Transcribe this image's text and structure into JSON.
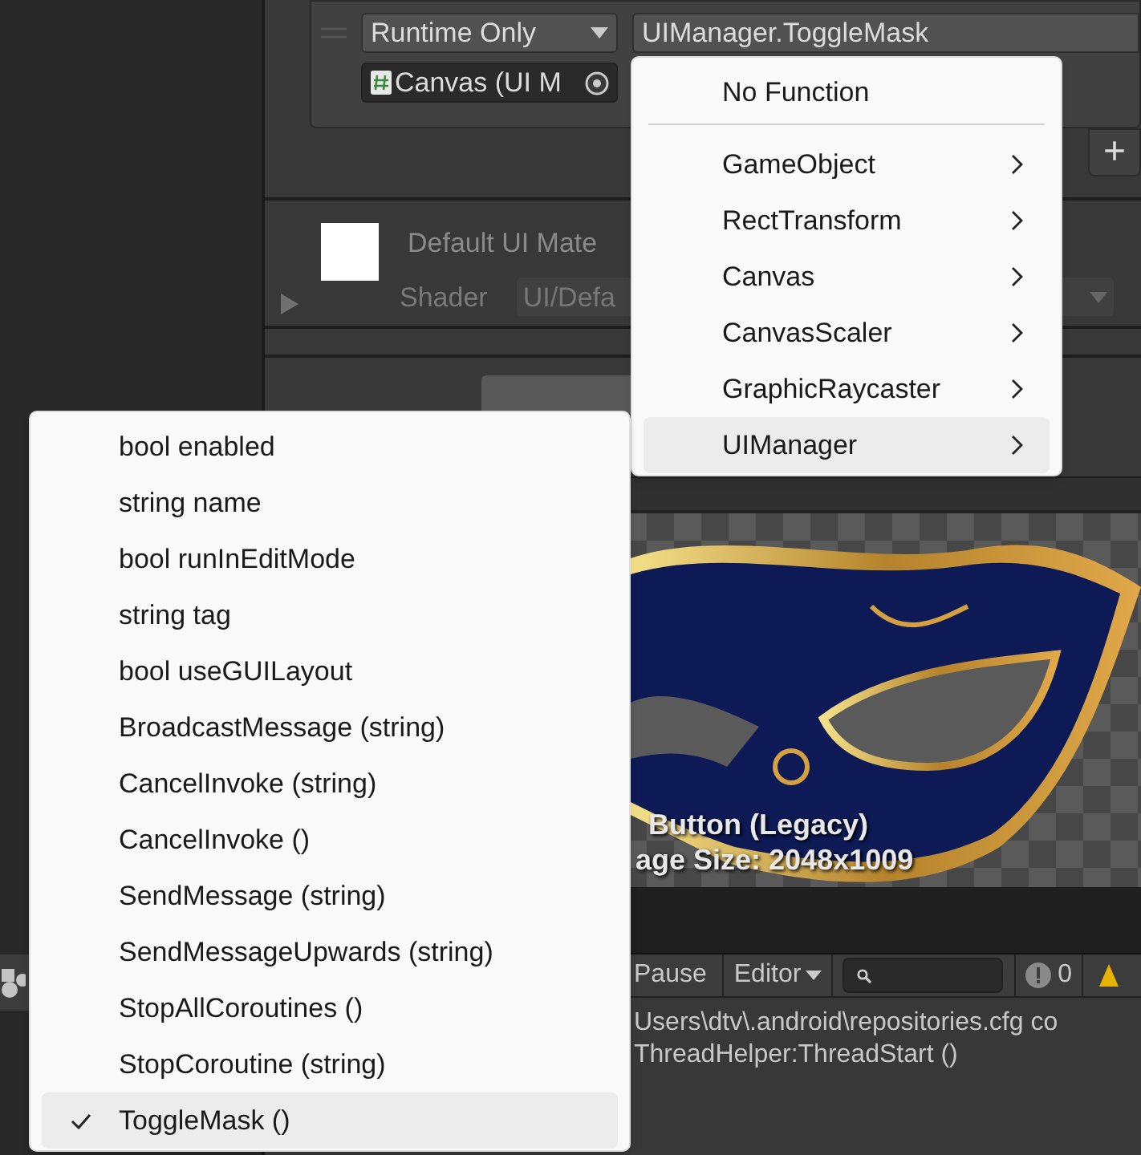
{
  "event": {
    "mode_dropdown": "Runtime Only",
    "function_field": "UIManager.ToggleMask",
    "target_field": "Canvas (UI M",
    "add_button": "+"
  },
  "material": {
    "name": "Default UI Mate",
    "shader_label": "Shader",
    "shader_dropdown": "UI/Defa"
  },
  "preview": {
    "lines": [
      "Button (Legacy)",
      "age Size: 2048x1009"
    ]
  },
  "console": {
    "pause": "Pause",
    "editor": "Editor",
    "error_count": "0",
    "lines": [
      "Users\\dtv\\.android\\repositories.cfg co",
      "ThreadHelper:ThreadStart ()"
    ]
  },
  "function_menu": {
    "items": [
      {
        "kind": "plain",
        "label": "No Function",
        "selected": false
      },
      {
        "kind": "separator"
      },
      {
        "kind": "submenu",
        "label": "GameObject",
        "selected": false
      },
      {
        "kind": "submenu",
        "label": "RectTransform",
        "selected": false
      },
      {
        "kind": "submenu",
        "label": "Canvas",
        "selected": false
      },
      {
        "kind": "submenu",
        "label": "CanvasScaler",
        "selected": false
      },
      {
        "kind": "submenu",
        "label": "GraphicRaycaster",
        "selected": false
      },
      {
        "kind": "submenu",
        "label": "UIManager",
        "selected": true
      }
    ]
  },
  "submenu": {
    "items": [
      {
        "label": "bool enabled",
        "checked": false,
        "selected": false
      },
      {
        "label": "string name",
        "checked": false,
        "selected": false
      },
      {
        "label": "bool runInEditMode",
        "checked": false,
        "selected": false
      },
      {
        "label": "string tag",
        "checked": false,
        "selected": false
      },
      {
        "label": "bool useGUILayout",
        "checked": false,
        "selected": false
      },
      {
        "label": "BroadcastMessage (string)",
        "checked": false,
        "selected": false
      },
      {
        "label": "CancelInvoke (string)",
        "checked": false,
        "selected": false
      },
      {
        "label": "CancelInvoke ()",
        "checked": false,
        "selected": false
      },
      {
        "label": "SendMessage (string)",
        "checked": false,
        "selected": false
      },
      {
        "label": "SendMessageUpwards (string)",
        "checked": false,
        "selected": false
      },
      {
        "label": "StopAllCoroutines ()",
        "checked": false,
        "selected": false
      },
      {
        "label": "StopCoroutine (string)",
        "checked": false,
        "selected": false
      },
      {
        "label": "ToggleMask ()",
        "checked": true,
        "selected": true
      }
    ]
  }
}
